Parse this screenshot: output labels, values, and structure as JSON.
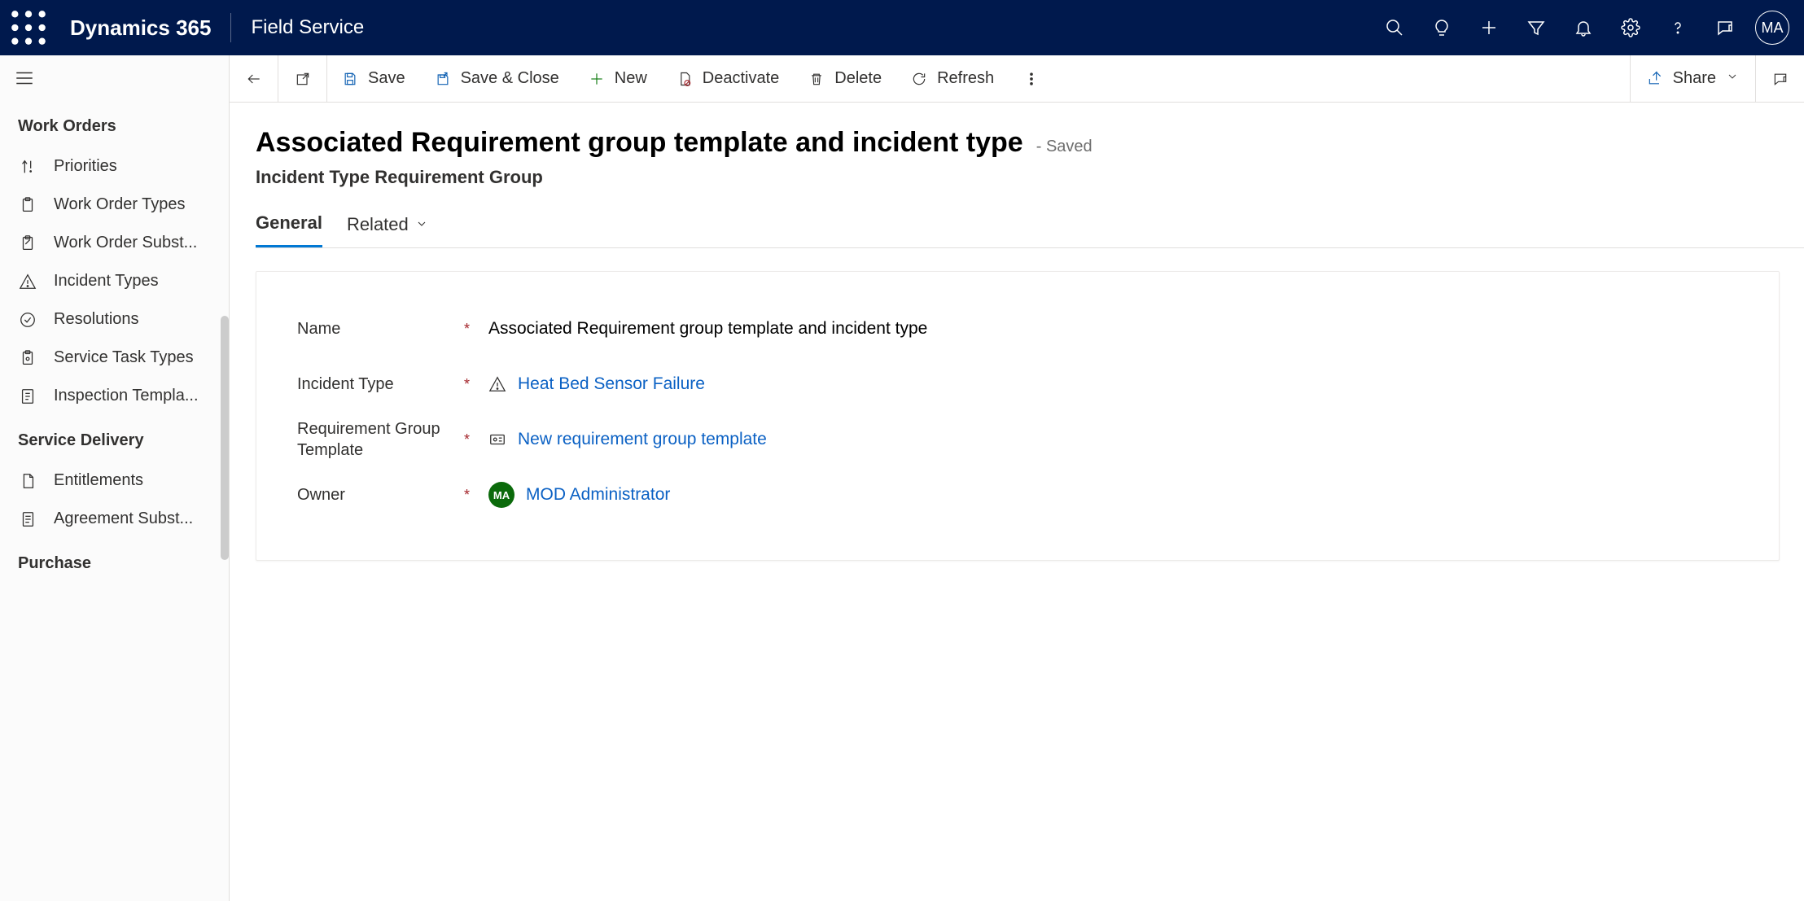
{
  "header": {
    "brand": "Dynamics 365",
    "app": "Field Service",
    "avatar": "MA"
  },
  "sidebar": {
    "section1": "Work Orders",
    "items1": [
      "Priorities",
      "Work Order Types",
      "Work Order Subst...",
      "Incident Types",
      "Resolutions",
      "Service Task Types",
      "Inspection Templa..."
    ],
    "section2": "Service Delivery",
    "items2": [
      "Entitlements",
      "Agreement Subst..."
    ],
    "section3": "Purchase"
  },
  "commands": {
    "save": "Save",
    "saveclose": "Save & Close",
    "new": "New",
    "deactivate": "Deactivate",
    "delete": "Delete",
    "refresh": "Refresh",
    "share": "Share"
  },
  "page": {
    "title": "Associated Requirement group template and incident type",
    "status": "- Saved",
    "subtitle": "Incident Type Requirement Group",
    "tabs": {
      "general": "General",
      "related": "Related"
    },
    "fields": {
      "name_label": "Name",
      "name_value": "Associated Requirement group template and incident type",
      "incident_label": "Incident Type",
      "incident_value": "Heat Bed Sensor Failure",
      "rgt_label": "Requirement Group Template",
      "rgt_value": "New requirement group template",
      "owner_label": "Owner",
      "owner_badge": "MA",
      "owner_value": "MOD Administrator"
    }
  }
}
